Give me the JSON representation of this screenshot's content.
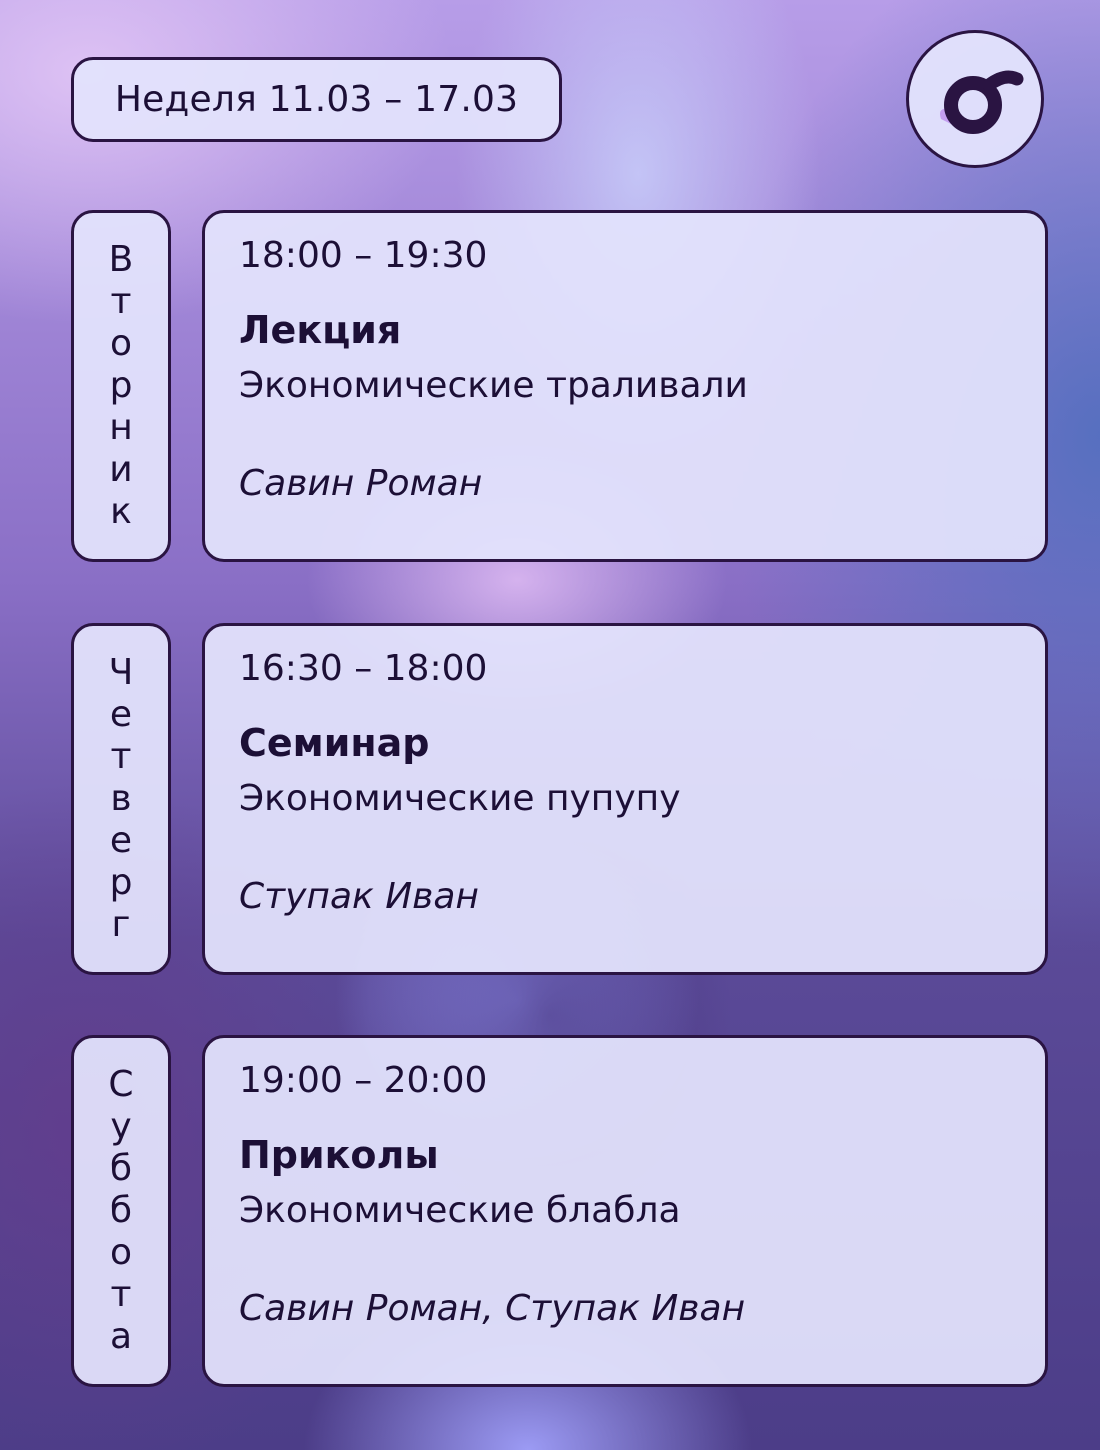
{
  "header": {
    "week_label": "Неделя 11.03 – 17.03",
    "logo_icon": "stylized-o-logo"
  },
  "schedule": [
    {
      "day": "Вторник",
      "day_letters": [
        "В",
        "т",
        "о",
        "р",
        "н",
        "и",
        "к"
      ],
      "time": "18:00 – 19:30",
      "kind": "Лекция",
      "subject": "Экономические траливали",
      "teacher": "Савин Роман"
    },
    {
      "day": "Четверг",
      "day_letters": [
        "Ч",
        "е",
        "т",
        "в",
        "е",
        "р",
        "г"
      ],
      "time": "16:30 – 18:00",
      "kind": "Семинар",
      "subject": "Экономические пупупу",
      "teacher": "Ступак Иван"
    },
    {
      "day": "Суббота",
      "day_letters": [
        "С",
        "у",
        "б",
        "б",
        "о",
        "т",
        "а"
      ],
      "time": "19:00 – 20:00",
      "kind": "Приколы",
      "subject": "Экономические блабла",
      "teacher": "Савин Роман, Ступак Иван"
    }
  ],
  "colors": {
    "ink": "#1c0f36",
    "border": "#2a1442",
    "card_bg": "#e2e2fc",
    "logo_accent": "#c49ef0"
  }
}
